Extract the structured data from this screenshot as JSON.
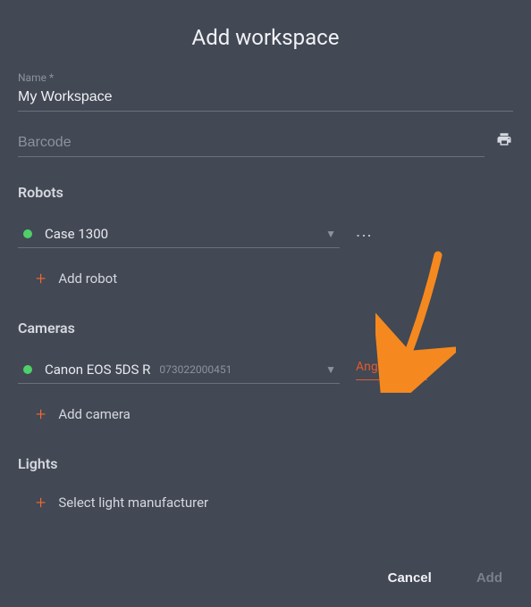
{
  "title": "Add workspace",
  "fields": {
    "name_label": "Name *",
    "name_value": "My Workspace",
    "barcode_placeholder": "Barcode"
  },
  "sections": {
    "robots": "Robots",
    "cameras": "Cameras",
    "lights": "Lights"
  },
  "robots": {
    "selected": "Case 1300",
    "add_label": "Add robot"
  },
  "cameras": {
    "selected": "Canon EOS 5DS R",
    "serial": "073022000451",
    "angle_label": "Angle *",
    "add_label": "Add camera"
  },
  "lights": {
    "select_label": "Select light manufacturer"
  },
  "buttons": {
    "cancel": "Cancel",
    "add": "Add"
  },
  "colors": {
    "accent": "#f26a2e",
    "error": "#e25a2f",
    "status_ok": "#4fd06a"
  }
}
